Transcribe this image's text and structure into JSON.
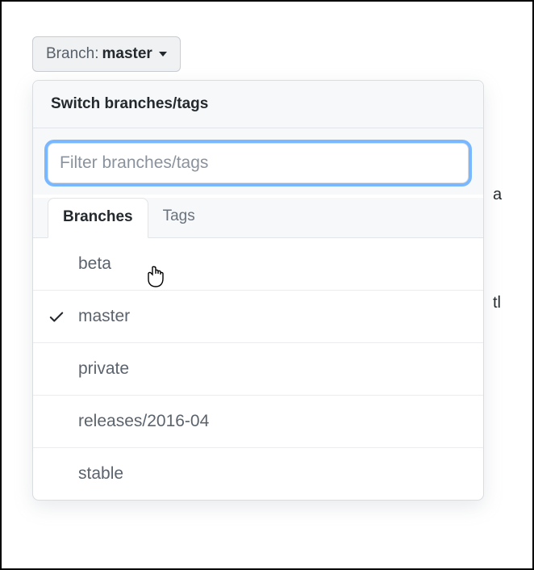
{
  "branchButton": {
    "label": "Branch:",
    "current": "master"
  },
  "dropdown": {
    "title": "Switch branches/tags",
    "filterPlaceholder": "Filter branches/tags",
    "tabs": {
      "branches": "Branches",
      "tags": "Tags"
    },
    "items": [
      {
        "name": "beta",
        "selected": false
      },
      {
        "name": "master",
        "selected": true
      },
      {
        "name": "private",
        "selected": false
      },
      {
        "name": "releases/2016-04",
        "selected": false
      },
      {
        "name": "stable",
        "selected": false
      }
    ]
  },
  "backgroundFragments": {
    "a": "a",
    "t": "tl"
  }
}
